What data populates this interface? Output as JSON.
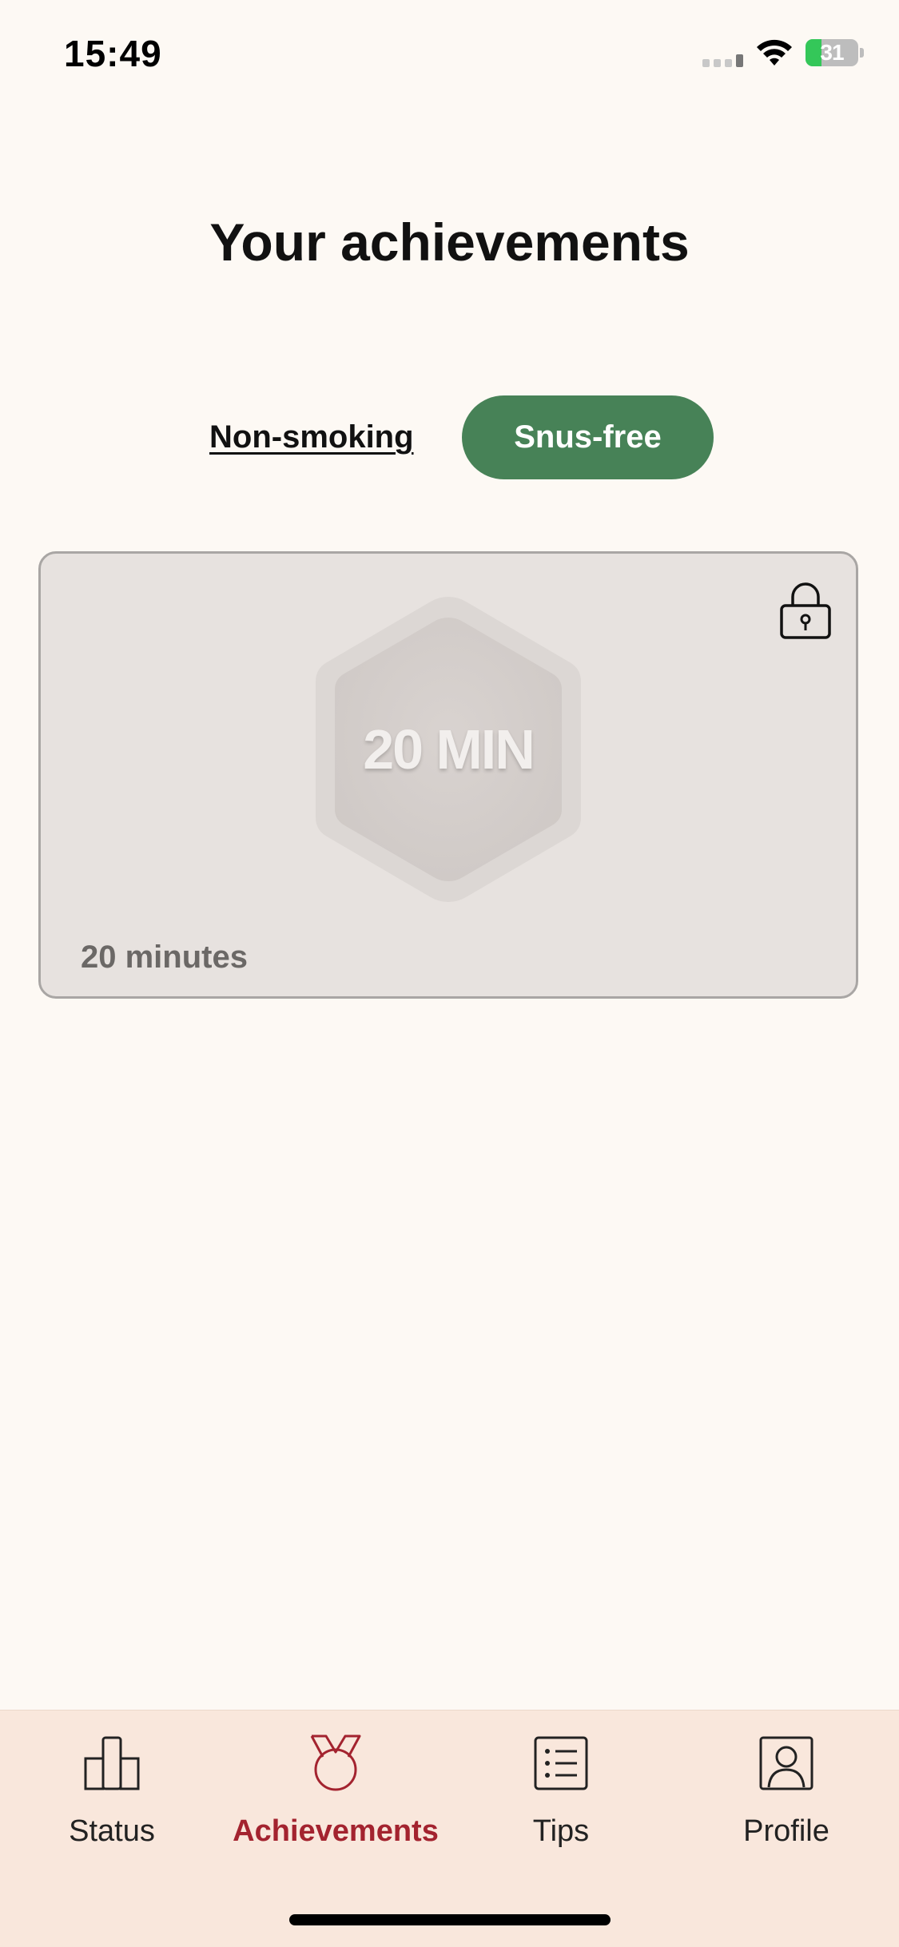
{
  "status_bar": {
    "time": "15:49",
    "battery_percent": "31",
    "battery_level": 0.31,
    "battery_charging": true,
    "icons": [
      "cellular-signal-icon",
      "wifi-icon",
      "battery-icon"
    ]
  },
  "page": {
    "title": "Your achievements"
  },
  "segments": {
    "tabs": [
      {
        "label": "Non-smoking",
        "selected": false
      },
      {
        "label": "Snus-free",
        "selected": true
      }
    ],
    "accent_color": "#478257"
  },
  "achievements": [
    {
      "badge_text": "20 MIN",
      "caption": "20 minutes",
      "locked": true,
      "icon": "lock-icon"
    }
  ],
  "tab_bar": {
    "items": [
      {
        "label": "Status",
        "icon": "status-chart-icon",
        "active": false
      },
      {
        "label": "Achievements",
        "icon": "medal-icon",
        "active": true
      },
      {
        "label": "Tips",
        "icon": "list-icon",
        "active": false
      },
      {
        "label": "Profile",
        "icon": "profile-icon",
        "active": false
      }
    ],
    "active_color": "#a3232f"
  }
}
